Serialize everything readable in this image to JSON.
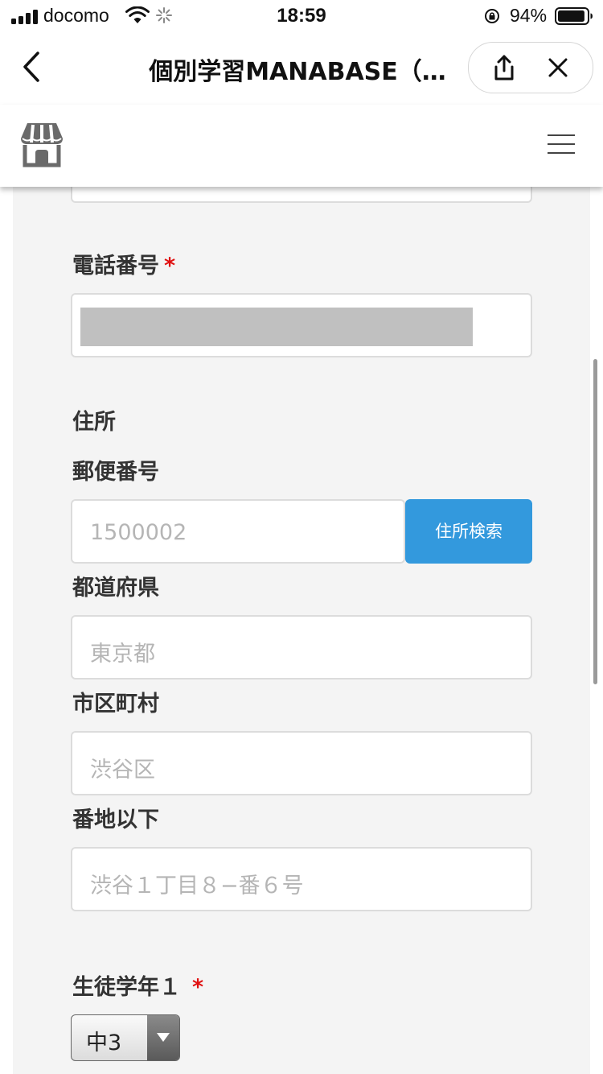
{
  "status_bar": {
    "carrier": "docomo",
    "time": "18:59",
    "battery": "94%",
    "battery_level": 0.94
  },
  "nav": {
    "title": "個別学習MANABASE（…",
    "back_icon": "chevron-left-icon",
    "share_icon": "share-icon",
    "close_icon": "close-icon"
  },
  "site_header": {
    "logo_icon": "storefront-icon",
    "menu_icon": "hamburger-menu-icon"
  },
  "form": {
    "phone": {
      "label": "電話番号",
      "required_mark": "*"
    },
    "address_section": "住所",
    "postal": {
      "label": "郵便番号",
      "placeholder": "1500002",
      "search_button": "住所検索"
    },
    "prefecture": {
      "label": "都道府県",
      "placeholder": "東京都"
    },
    "city": {
      "label": "市区町村",
      "placeholder": "渋谷区"
    },
    "street": {
      "label": "番地以下",
      "placeholder": "渋谷１丁目８−番６号"
    },
    "grade": {
      "label": "生徒学年１",
      "required_mark": "*",
      "selected": "中3"
    }
  },
  "colors": {
    "accent": "#3399dd",
    "required": "#e01010",
    "panel": "#f4f4f4"
  }
}
